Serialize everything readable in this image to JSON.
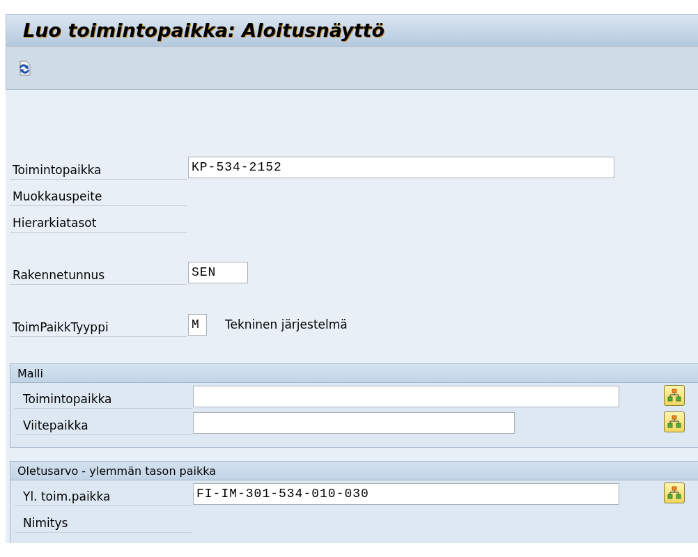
{
  "window": {
    "title": "Luo toimintopaikka: Aloitusnäyttö"
  },
  "toolbar": {
    "buttons": [
      {
        "kind": "refresh"
      }
    ]
  },
  "field_groups": [
    {
      "rows": [
        {
          "label": "Toimintopaikka",
          "kind": "long",
          "value": "KP-534-2152"
        },
        {
          "label": "Muokkauspeite",
          "kind": "none"
        },
        {
          "label": "Hierarkiatasot",
          "kind": "none"
        }
      ]
    },
    {
      "rows": [
        {
          "label": "Rakennetunnus",
          "kind": "short",
          "value": "SEN"
        }
      ]
    },
    {
      "rows": [
        {
          "label": "ToimPaikkTyyppi",
          "kind": "char",
          "value": "M",
          "description": "Tekninen järjestelmä"
        }
      ]
    }
  ],
  "sections": [
    {
      "title": "Malli",
      "rows": [
        {
          "label": "Toimintopaikka",
          "kind": "long",
          "value": "",
          "hierarchy_button": true
        },
        {
          "label": "Viitepaikka",
          "kind": "medium",
          "value": "",
          "hierarchy_button": true
        }
      ]
    },
    {
      "title": "Oletusarvo - ylemmän tason paikka",
      "rows": [
        {
          "label": "Yl. toim.paikka",
          "kind": "long",
          "value": "FI-IM-301-534-010-030",
          "hierarchy_button": true
        },
        {
          "label": "Nimitys",
          "kind": "none"
        }
      ]
    }
  ]
}
